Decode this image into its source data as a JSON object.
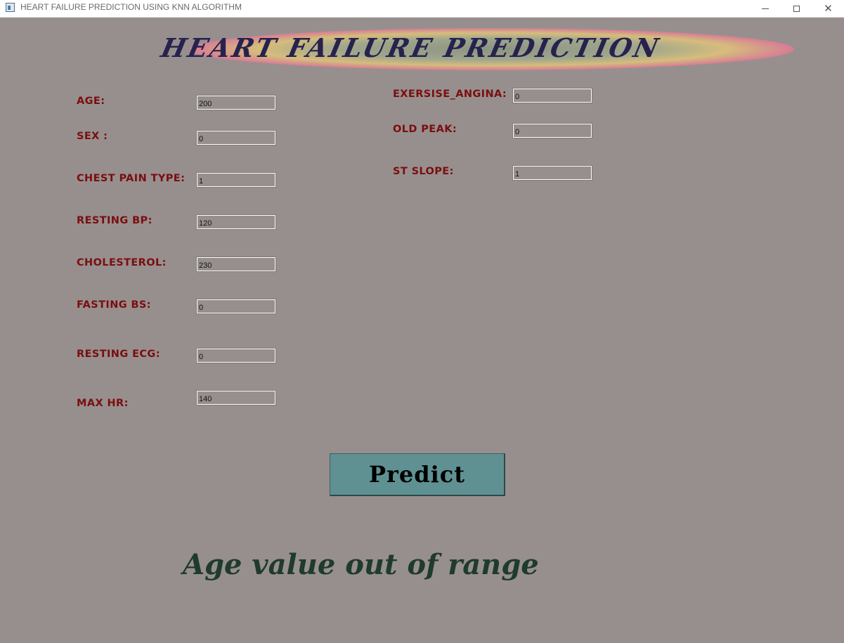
{
  "window": {
    "title": "HEART FAILURE PREDICTION USING KNN ALGORITHM",
    "controls": {
      "minimize": "—",
      "maximize": "☐",
      "close": "✕"
    }
  },
  "banner": {
    "title": "HEART FAILURE PREDICTION"
  },
  "form": {
    "left": [
      {
        "label": "AGE:",
        "value": "200"
      },
      {
        "label": "SEX :",
        "value": "0"
      },
      {
        "label": "CHEST PAIN TYPE:",
        "value": "1"
      },
      {
        "label": "RESTING BP:",
        "value": "120"
      },
      {
        "label": "CHOLESTEROL:",
        "value": "230"
      },
      {
        "label": "FASTING BS:",
        "value": "0"
      },
      {
        "label": "RESTING ECG:",
        "value": "0"
      },
      {
        "label": "MAX HR:",
        "value": "140"
      }
    ],
    "right": [
      {
        "label": "EXERSISE_ANGINA:",
        "value": "0"
      },
      {
        "label": "OLD PEAK:",
        "value": "0"
      },
      {
        "label": "ST SLOPE:",
        "value": "1"
      }
    ]
  },
  "predict_button": {
    "label": "Predict"
  },
  "result": {
    "message": "Age value out of range"
  },
  "colors": {
    "background": "#978f8e",
    "label": "#7a0e0e",
    "banner_text": "#27224d",
    "button": "#5f9193",
    "result_text": "#1f3b2c"
  }
}
